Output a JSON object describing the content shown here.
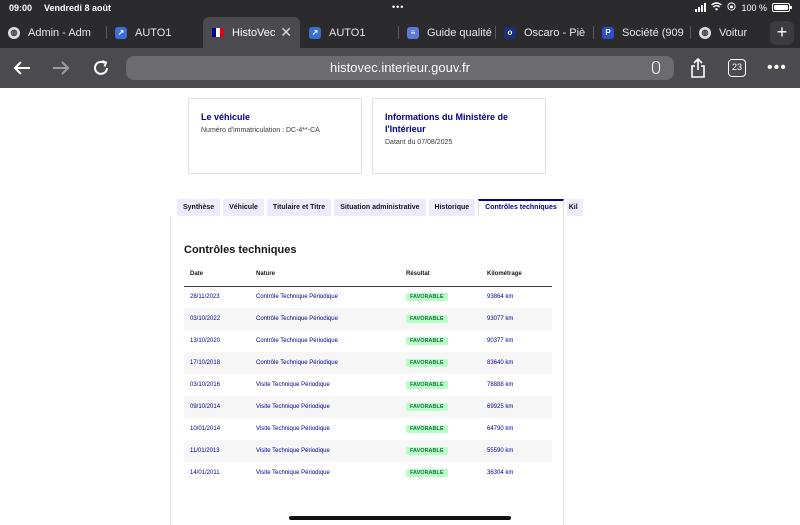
{
  "status": {
    "time": "09:00",
    "date": "Vendredi 8 août",
    "battery": "100 %"
  },
  "tabs": [
    {
      "label": "Admin - Adm",
      "icon": "globe-icon"
    },
    {
      "label": "AUTO1",
      "icon": "auto1-icon"
    },
    {
      "label": "HistoVec",
      "icon": "marianne-flag-icon",
      "active": true
    },
    {
      "label": "AUTO1",
      "icon": "auto1-icon"
    },
    {
      "label": "Guide qualité",
      "icon": "guide-icon"
    },
    {
      "label": "Oscaro - Piè",
      "icon": "oscaro-icon"
    },
    {
      "label": "Société (909",
      "icon": "pappers-icon"
    },
    {
      "label": "Voitur",
      "icon": "globe-icon"
    }
  ],
  "toolbar": {
    "url": "histovec.interieur.gouv.fr",
    "tab_count": "23"
  },
  "cards": {
    "vehicle": {
      "title": "Le véhicule",
      "subtitle": "Numéro d'immatriculation : DC-4**-CA"
    },
    "ministry": {
      "title": "Informations du Ministère de l'Intérieur",
      "subtitle": "Datant du 07/08/2025"
    }
  },
  "page_tabs": [
    "Synthèse",
    "Véhicule",
    "Titulaire et Titre",
    "Situation administrative",
    "Historique",
    "Contrôles techniques",
    "Kil"
  ],
  "active_page_tab": "Contrôles techniques",
  "section_title": "Contrôles techniques",
  "table": {
    "headers": {
      "date": "Date",
      "nature": "Nature",
      "result": "Résultat",
      "km": "Kilométrage"
    },
    "rows": [
      {
        "date": "28/11/2023",
        "nature": "Contrôle Technique Périodique",
        "result": "FAVORABLE",
        "km": "93864 km"
      },
      {
        "date": "03/10/2022",
        "nature": "Contrôle Technique Périodique",
        "result": "FAVORABLE",
        "km": "93077 km"
      },
      {
        "date": "13/10/2020",
        "nature": "Contrôle Technique Périodique",
        "result": "FAVORABLE",
        "km": "90377 km"
      },
      {
        "date": "17/10/2018",
        "nature": "Contrôle Technique Périodique",
        "result": "FAVORABLE",
        "km": "83640 km"
      },
      {
        "date": "03/10/2016",
        "nature": "Visite Technique Périodique",
        "result": "FAVORABLE",
        "km": "78888 km"
      },
      {
        "date": "09/10/2014",
        "nature": "Visite Technique Périodique",
        "result": "FAVORABLE",
        "km": "69925 km"
      },
      {
        "date": "10/01/2014",
        "nature": "Visite Technique Périodique",
        "result": "FAVORABLE",
        "km": "64790 km"
      },
      {
        "date": "11/01/2013",
        "nature": "Visite Technique Périodique",
        "result": "FAVORABLE",
        "km": "55590 km"
      },
      {
        "date": "14/01/2011",
        "nature": "Visite Technique Périodique",
        "result": "FAVORABLE",
        "km": "36304 km"
      }
    ]
  },
  "colors": {
    "accent": "#000091",
    "badge_bg": "#b8fec9",
    "badge_text": "#18753c",
    "chrome": "#2b2b2e"
  }
}
